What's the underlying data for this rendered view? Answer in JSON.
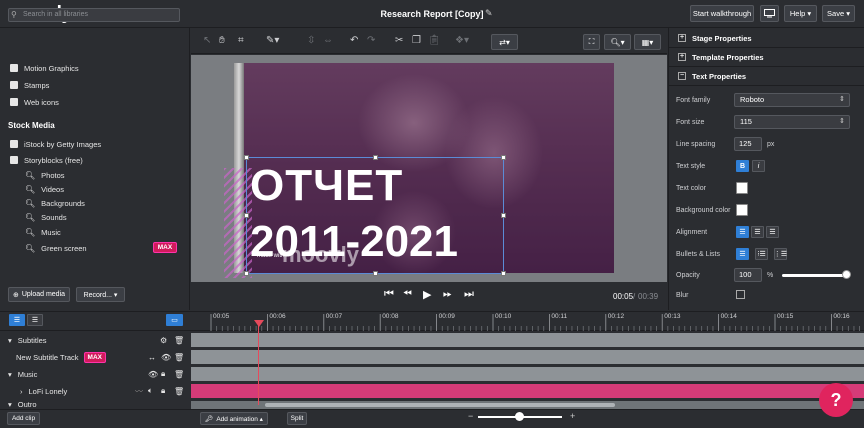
{
  "app": {
    "logo": "moovly",
    "document_title": "Research Report [Copy]"
  },
  "topbar": {
    "walkthrough_label": "Start walkthrough",
    "help_label": "Help ▾",
    "save_label": "Save ▾"
  },
  "library": {
    "search_placeholder": "Search in all libraries",
    "items": [
      "Motion Graphics",
      "Stamps",
      "Web icons"
    ],
    "stock_heading": "Stock Media",
    "stock_items": [
      "iStock by Getty Images",
      "Storyblocks (free)"
    ],
    "storyblocks_sub": [
      "Photos",
      "Videos",
      "Backgrounds",
      "Sounds",
      "Music",
      "Green screen"
    ],
    "max_badge": "MAX",
    "upload_label": "Upload media",
    "record_label": "Record... ▾"
  },
  "canvas": {
    "title_line1": "ОТЧЕТ",
    "title_line2": "2011-2021",
    "watermark_small": "made with",
    "watermark_logo": "moovly"
  },
  "playback": {
    "current_time": "00:05",
    "separator": "/",
    "total_time": "00:39"
  },
  "properties": {
    "sections": [
      "Stage Properties",
      "Template Properties",
      "Text Properties"
    ],
    "font_family_label": "Font family",
    "font_family_value": "Roboto",
    "font_size_label": "Font size",
    "font_size_value": "115",
    "line_spacing_label": "Line spacing",
    "line_spacing_value": "125",
    "line_spacing_unit": "px",
    "text_style_label": "Text style",
    "text_color_label": "Text color",
    "background_color_label": "Background color",
    "alignment_label": "Alignment",
    "bullets_label": "Bullets & Lists",
    "opacity_label": "Opacity",
    "opacity_value": "100",
    "opacity_unit": "%",
    "opacity_level": 1.0,
    "blur_label": "Blur"
  },
  "timeline": {
    "ticks": [
      "00:05",
      "00:06",
      "00:07",
      "00:08",
      "00:09",
      "00:10",
      "00:11",
      "00:12",
      "00:13",
      "00:14",
      "00:15",
      "00:16"
    ],
    "tracks": {
      "subtitles": "Subtitles",
      "new_subtitle_track": "New Subtitle Track",
      "new_subtitle_badge": "MAX",
      "music": "Music",
      "lofi": "LoFi Lonely",
      "outro": "Outro"
    },
    "add_clip": "Add clip",
    "add_animation": "Add animation ▴",
    "split": "Split",
    "help_fab": "?"
  },
  "colors": {
    "accent_blue": "#2f7fd6",
    "brand_pink": "#e0245e",
    "music_track": "#d63b78"
  }
}
